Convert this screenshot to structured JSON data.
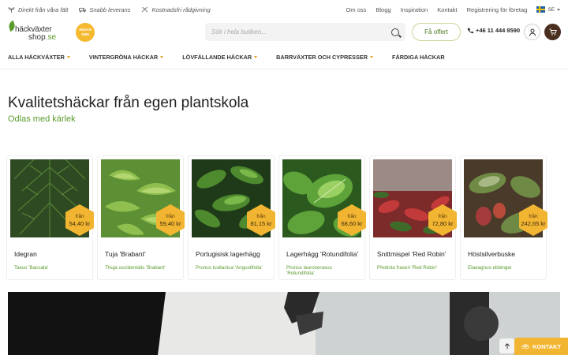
{
  "topbar": {
    "usps": [
      {
        "icon": "sprout-icon",
        "label": "Direkt från våra fält"
      },
      {
        "icon": "truck-icon",
        "label": "Snabb leverans"
      },
      {
        "icon": "tools-icon",
        "label": "Kostnadsfri rådgivning"
      }
    ],
    "links": [
      "Om oss",
      "Blogg",
      "Inspiration",
      "Kontakt",
      "Registrering för företag"
    ],
    "language": "SE"
  },
  "header": {
    "logo_line1": "häckväxter",
    "logo_line2": "shop",
    "logo_tld": ".se",
    "badge_line1": "SEDAN",
    "badge_line2": "1985",
    "search_placeholder": "Sök i hela butiken...",
    "offer_button": "Få offert",
    "phone": "+46 11 444 8590"
  },
  "nav": {
    "items": [
      {
        "label": "ALLA HÄCKVÄXTER",
        "dropdown": true
      },
      {
        "label": "VINTERGRÖNA HÄCKAR",
        "dropdown": true
      },
      {
        "label": "LÖVFÄLLANDE HÄCKAR",
        "dropdown": true
      },
      {
        "label": "BARRVÄXTER OCH CYPRESSER",
        "dropdown": true
      },
      {
        "label": "FÄRDIGA HÄCKAR",
        "dropdown": false
      }
    ]
  },
  "hero": {
    "title": "Kvalitetshäckar från egen plantskola",
    "subtitle": "Odlas med kärlek"
  },
  "products": [
    {
      "name": "Idegran",
      "latin": "Taxus 'Baccata'",
      "from": "från",
      "price": "54,40 kr"
    },
    {
      "name": "Tuja 'Brabant'",
      "latin": "Thuja occidentalis 'Brabant'",
      "from": "från",
      "price": "59,40 kr"
    },
    {
      "name": "Portugisisk lagerhägg",
      "latin": "Prunus lusitanica 'Angustifolia'",
      "from": "från",
      "price": "81,15 kr"
    },
    {
      "name": "Lagerhägg 'Rotundifolia'",
      "latin": "Prunus laurocerasus 'Rotundifolia'",
      "from": "från",
      "price": "68,60 kr"
    },
    {
      "name": "Snittmispel 'Red Robin'",
      "latin": "Photinia fraseri 'Red Robin'",
      "from": "från",
      "price": "72,80 kr"
    },
    {
      "name": "Höstsilverbuske",
      "latin": "Elaeagnus ebbingei",
      "from": "från",
      "price": "242,65 kr"
    }
  ],
  "footer_widgets": {
    "contact_label": "KONTAKT"
  },
  "colors": {
    "accent_green": "#5a9b2d",
    "price_badge": "#f2b531",
    "cart_brown": "#4a2e1f"
  }
}
